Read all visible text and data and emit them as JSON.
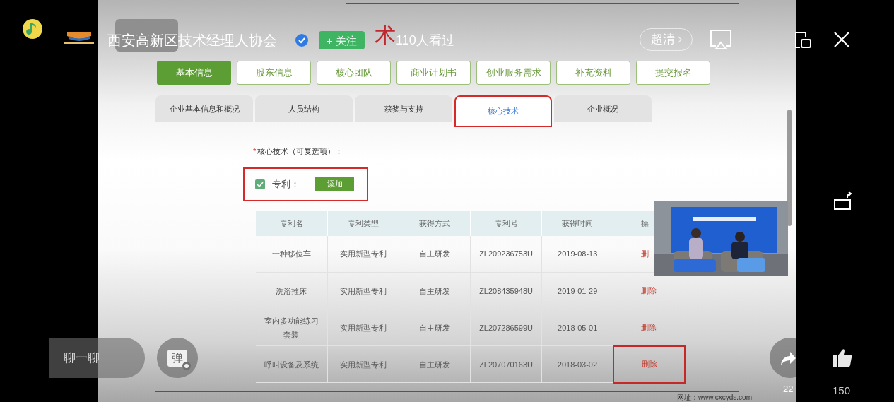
{
  "player": {
    "channel_name": "西安高新区技术经理人协会",
    "follow_button": "+ 关注",
    "views": "110人看过",
    "quality": "超清",
    "chat_button": "聊一聊",
    "danmaku_label": "弹",
    "share_count": "22",
    "like_count": "150"
  },
  "slide": {
    "title_highlight": "术",
    "nav_buttons": [
      {
        "label": "基本信息",
        "selected": true
      },
      {
        "label": "股东信息",
        "selected": false
      },
      {
        "label": "核心团队",
        "selected": false
      },
      {
        "label": "商业计划书",
        "selected": false
      },
      {
        "label": "创业服务需求",
        "selected": false
      },
      {
        "label": "补充资料",
        "selected": false
      },
      {
        "label": "提交报名",
        "selected": false
      }
    ],
    "tabs": [
      {
        "label": "企业基本信息和概况",
        "selected": false,
        "annotated": false
      },
      {
        "label": "人员结构",
        "selected": false,
        "annotated": false
      },
      {
        "label": "获奖与支持",
        "selected": false,
        "annotated": false
      },
      {
        "label": "核心技术",
        "selected": true,
        "annotated": true
      },
      {
        "label": "企业概况",
        "selected": false,
        "annotated": false
      }
    ],
    "required_mark": "*",
    "field_label": "核心技术（可复选项）：",
    "patent_option": {
      "label": "专利：",
      "checked": true,
      "add_button": "添加",
      "annotated": true
    },
    "table": {
      "columns": [
        "专利名",
        "专利类型",
        "获得方式",
        "专利号",
        "获得时间",
        "操"
      ],
      "rows": [
        {
          "cells": [
            "一种移位车",
            "实用新型专利",
            "自主研发",
            "ZL209236753U",
            "2019-08-13"
          ],
          "action": "删",
          "annotated": false
        },
        {
          "cells": [
            "洗浴推床",
            "实用新型专利",
            "自主研发",
            "ZL208435948U",
            "2019-01-29"
          ],
          "action": "删除",
          "annotated": false
        },
        {
          "cells": [
            "室内多功能练习套装",
            "实用新型专利",
            "自主研发",
            "ZL207286599U",
            "2018-05-01"
          ],
          "action": "删除",
          "annotated": false
        },
        {
          "cells": [
            "呼叫设备及系统",
            "实用新型专利",
            "自主研发",
            "ZL207070163U",
            "2018-03-02"
          ],
          "action": "删除",
          "annotated": true
        }
      ]
    },
    "website": "网址：www.cxcyds.com"
  }
}
